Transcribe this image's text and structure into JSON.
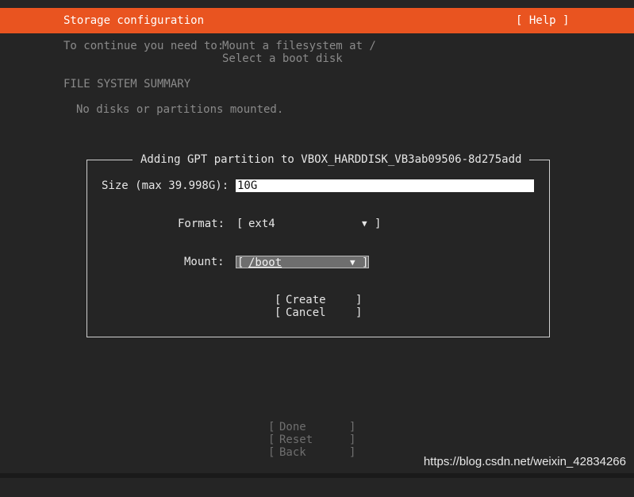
{
  "header": {
    "title": "Storage configuration",
    "help_label": "[ Help ]"
  },
  "instructions": {
    "prefix": "To continue you need to:",
    "line1": "Mount a filesystem at /",
    "line2": "Select a boot disk"
  },
  "summary": {
    "heading": "FILE SYSTEM SUMMARY",
    "empty_text": "No disks or partitions mounted."
  },
  "dialog": {
    "title": "Adding GPT partition to VBOX_HARDDISK_VB3ab09506-8d275add",
    "size_label": "Size (max 39.998G):",
    "size_value": "10G",
    "format_label": "Format:",
    "format_value": "ext4",
    "mount_label": "Mount:",
    "mount_value": "/boot",
    "create_label": "Create",
    "cancel_label": "Cancel"
  },
  "footer": {
    "done_label": "Done",
    "reset_label": "Reset",
    "back_label": "Back"
  },
  "watermark": "https://blog.csdn.net/weixin_42834266",
  "colors": {
    "accent": "#e95420",
    "background": "#252525"
  }
}
